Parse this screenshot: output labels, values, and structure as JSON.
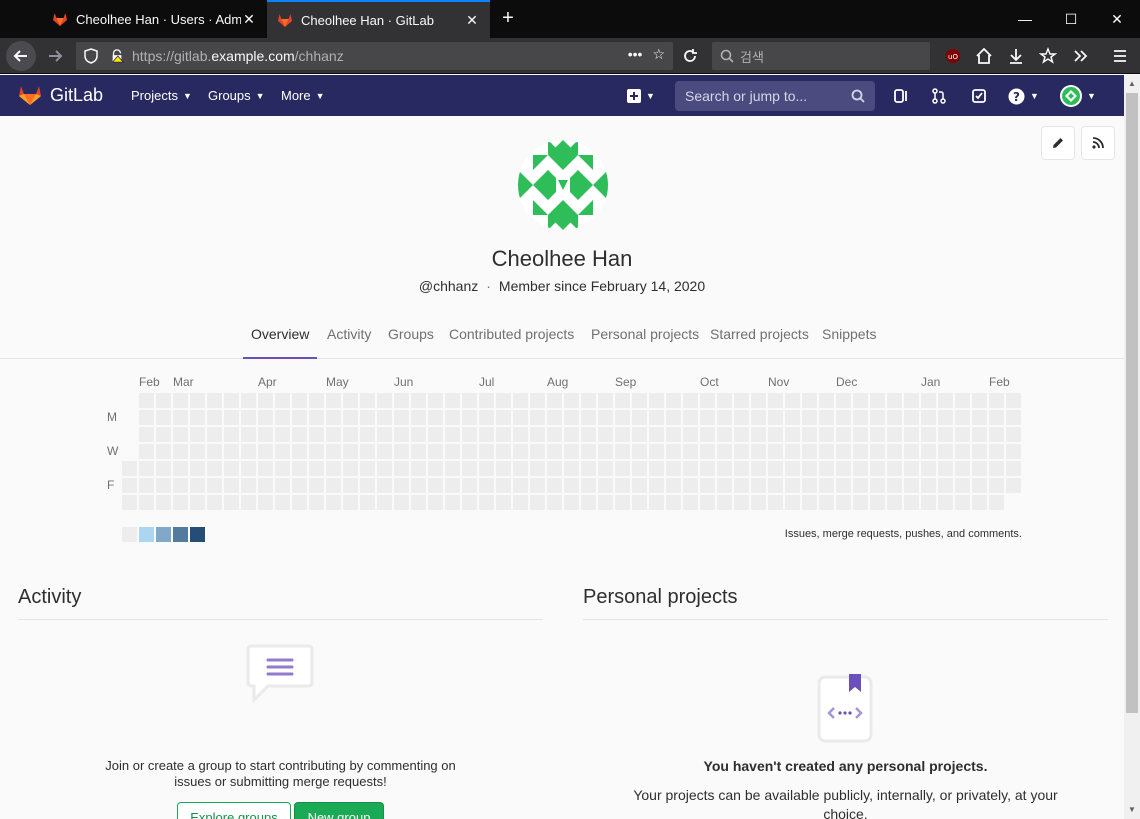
{
  "browser": {
    "tabs": [
      {
        "title": "Cheolhee Han · Users · Admin"
      },
      {
        "title": "Cheolhee Han · GitLab"
      }
    ],
    "url_prefix": "https://gitlab.",
    "url_host": "example.com",
    "url_path": "/chhanz",
    "search_placeholder": "검색"
  },
  "gitlab": {
    "brand": "GitLab",
    "menu": [
      {
        "label": "Projects"
      },
      {
        "label": "Groups"
      },
      {
        "label": "More"
      }
    ],
    "search_placeholder": "Search or jump to..."
  },
  "profile": {
    "name": "Cheolhee Han",
    "username": "@chhanz",
    "member_since": "Member since February 14, 2020",
    "tabs": [
      "Overview",
      "Activity",
      "Groups",
      "Contributed projects",
      "Personal projects",
      "Starred projects",
      "Snippets"
    ],
    "active_tab": "Overview"
  },
  "calendar": {
    "months": [
      "Feb",
      "Mar",
      "Apr",
      "May",
      "Jun",
      "Jul",
      "Aug",
      "Sep",
      "Oct",
      "Nov",
      "Dec",
      "Jan",
      "Feb"
    ],
    "day_labels": [
      "M",
      "W",
      "F"
    ],
    "legend_colors": [
      "#ededed",
      "#acd5f2",
      "#7fa8c9",
      "#527ba0",
      "#254e77"
    ],
    "note": "Issues, merge requests, pushes, and comments."
  },
  "activity": {
    "heading": "Activity",
    "empty_line1": "Join or create a group to start contributing by commenting on",
    "empty_line2": "issues or submitting merge requests!",
    "explore_button": "Explore groups",
    "new_button": "New group"
  },
  "personal_projects": {
    "heading": "Personal projects",
    "empty_title": "You haven't created any personal projects.",
    "empty_line1": "Your projects can be available publicly, internally, or privately, at your",
    "empty_line2": "choice."
  },
  "colors": {
    "header_bg": "#292961",
    "accent": "#6b4fbb",
    "avatar_green": "#2ebd59",
    "success": "#1aaa55"
  }
}
